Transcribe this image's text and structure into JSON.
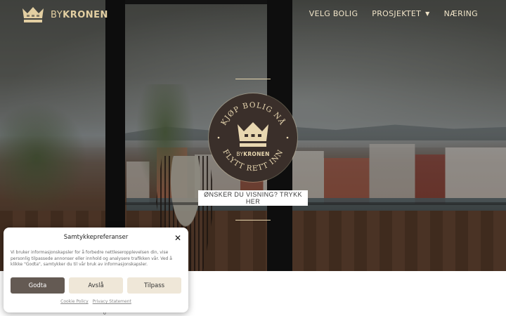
{
  "header": {
    "logo": {
      "prefix": "BY",
      "name": "KRONEN"
    },
    "nav": [
      {
        "label": "VELG BOLIG"
      },
      {
        "label": "PROSJEKTET",
        "has_dropdown": true
      },
      {
        "label": "NÆRING"
      }
    ]
  },
  "hero": {
    "badge": {
      "top_arc": "KJØP BOLIG NÅ",
      "bottom_arc": "FLYTT RETT INN",
      "logo_prefix": "BY",
      "logo_name": "KRONEN"
    },
    "cta_label": "ØNSKER DU VISNING? TRYKK HER"
  },
  "consent": {
    "title": "Samtykkepreferanser",
    "close_glyph": "✕",
    "body": "Vi bruker informasjonskapsler for å forbedre nettleseropplevelsen din, vise personlig tilpassede annonser eller innhold og analysere trafikken vår. Ved å klikke \"Godta\", samtykker du til vår bruk av informasjonskapsler.",
    "buttons": {
      "accept": "Godta",
      "deny": "Avslå",
      "customize": "Tilpass"
    },
    "links": {
      "cookie_policy": "Cookie Policy",
      "privacy": "Privacy Statement"
    }
  },
  "below_hero": {
    "partial_glyph": "0"
  },
  "colors": {
    "gold": "#e3cfa2",
    "badge_bg": "#3a2f2a",
    "accept_bg": "#645a53",
    "secondary_bg": "#efe7d8"
  }
}
